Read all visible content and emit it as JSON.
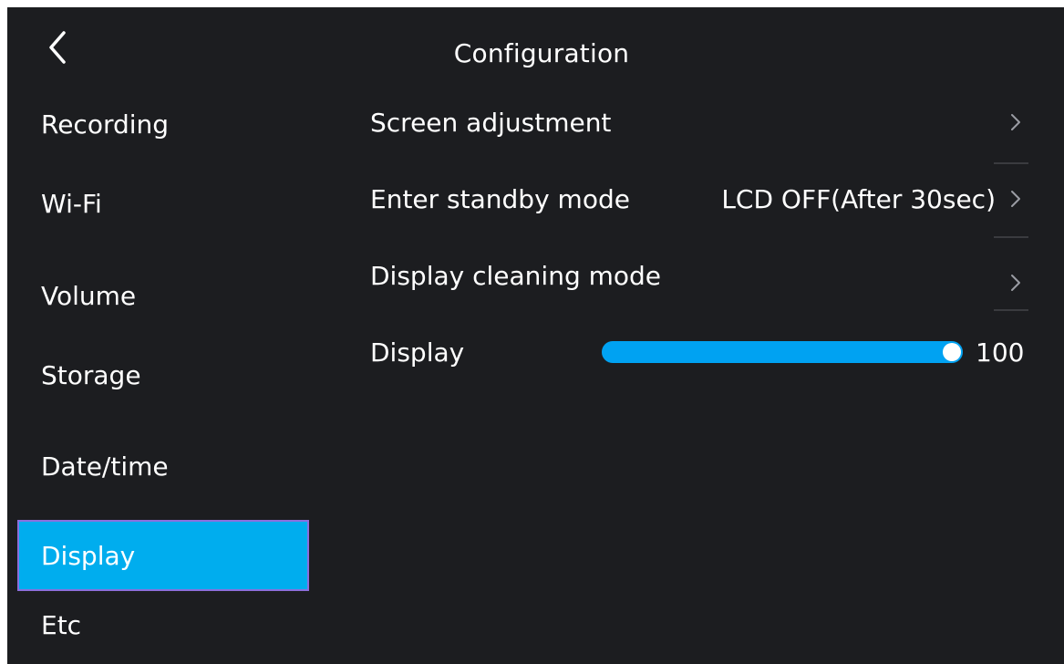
{
  "header": {
    "title": "Configuration",
    "back_icon": "chevron-left-icon"
  },
  "sidebar": {
    "items": [
      {
        "label": "Recording",
        "active": false
      },
      {
        "label": "Wi-Fi",
        "active": false
      },
      {
        "label": "Volume",
        "active": false
      },
      {
        "label": "Storage",
        "active": false
      },
      {
        "label": "Date/time",
        "active": false
      },
      {
        "label": "Display",
        "active": true
      },
      {
        "label": "Etc",
        "active": false
      }
    ]
  },
  "settings": {
    "screen_adjustment": {
      "label": "Screen adjustment",
      "value": ""
    },
    "standby_mode": {
      "label": "Enter standby mode",
      "value": "LCD OFF(After 30sec)"
    },
    "cleaning_mode": {
      "label": "Display cleaning mode",
      "value": ""
    },
    "brightness": {
      "label": "Display",
      "value": 100,
      "max": 100,
      "value_text": "100"
    }
  },
  "colors": {
    "background": "#1c1d20",
    "active_item": "#00adee",
    "active_border": "#8b6fdc",
    "slider_fill": "#00a2f2"
  }
}
